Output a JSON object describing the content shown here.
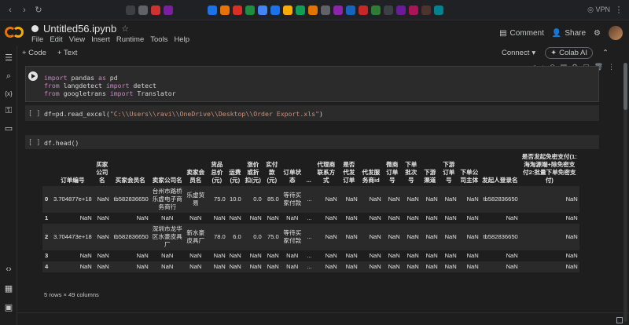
{
  "browser": {
    "vpn_label": "VPN"
  },
  "notebook": {
    "title": "Untitled56.ipynb",
    "menu": [
      "File",
      "Edit",
      "View",
      "Insert",
      "Runtime",
      "Tools",
      "Help"
    ],
    "comment_label": "Comment",
    "share_label": "Share"
  },
  "toolbar": {
    "code_label": "+ Code",
    "text_label": "+ Text",
    "connect_label": "Connect",
    "colab_ai_label": "Colab AI"
  },
  "cells": {
    "cell1": {
      "line1": [
        "import",
        " pandas ",
        "as",
        " pd"
      ],
      "line2": [
        "from",
        " langdetect ",
        "import",
        " detect"
      ],
      "line3": [
        "from",
        " googletrans ",
        "import",
        " Translator"
      ]
    },
    "cell2": {
      "prompt": "[ ]",
      "code_a": "df=pd.read_excel(",
      "code_str": "\"C:\\\\Users\\\\ravi\\\\OneDrive\\\\Desktop\\\\Order Export.xls\"",
      "code_b": ")"
    },
    "cell3": {
      "prompt": "[ ]",
      "code": "df.head()"
    }
  },
  "table": {
    "headers": [
      "",
      "订单编号",
      "买家公司名",
      "买家会员名",
      "卖家公司名",
      "卖家会员名",
      "货品总价(元)",
      "运费(元)",
      "涨价或折扣(元)",
      "实付款(元)",
      "订单状态",
      "...",
      "代理商联系方式",
      "是否代发订单",
      "代发服务商id",
      "微商订单号",
      "下单批次号",
      "下游渠道",
      "下游订单号",
      "下单公司主体",
      "发起人登录名",
      "是否发起免密支付(1:海淘源端+除免密支付2:批量下单免密支付)"
    ],
    "rows": [
      [
        "0",
        "3.704877e+18",
        "NaN",
        "tb582836650",
        "台州市路桥乐虚电子商务商行",
        "乐虚贸易",
        "75.0",
        "10.0",
        "0.0",
        "85.0",
        "等待买家付款",
        "...",
        "NaN",
        "NaN",
        "NaN",
        "NaN",
        "NaN",
        "NaN",
        "NaN",
        "NaN",
        "tb582836650",
        "NaN"
      ],
      [
        "1",
        "NaN",
        "NaN",
        "NaN",
        "NaN",
        "NaN",
        "NaN",
        "NaN",
        "NaN",
        "NaN",
        "NaN",
        "...",
        "NaN",
        "NaN",
        "NaN",
        "NaN",
        "NaN",
        "NaN",
        "NaN",
        "NaN",
        "NaN",
        "NaN"
      ],
      [
        "2",
        "3.704473e+18",
        "NaN",
        "tb582836650",
        "深圳市龙华区水豪皮具厂",
        "新水豪皮具厂",
        "78.0",
        "6.0",
        "0.0",
        "75.0",
        "等待买家付款",
        "...",
        "NaN",
        "NaN",
        "NaN",
        "NaN",
        "NaN",
        "NaN",
        "NaN",
        "NaN",
        "tb582836650",
        "NaN"
      ],
      [
        "3",
        "NaN",
        "NaN",
        "NaN",
        "NaN",
        "NaN",
        "NaN",
        "NaN",
        "NaN",
        "NaN",
        "NaN",
        "...",
        "NaN",
        "NaN",
        "NaN",
        "NaN",
        "NaN",
        "NaN",
        "NaN",
        "NaN",
        "NaN",
        "NaN"
      ],
      [
        "4",
        "NaN",
        "NaN",
        "NaN",
        "NaN",
        "NaN",
        "NaN",
        "NaN",
        "NaN",
        "NaN",
        "NaN",
        "...",
        "NaN",
        "NaN",
        "NaN",
        "NaN",
        "NaN",
        "NaN",
        "NaN",
        "NaN",
        "NaN",
        "NaN"
      ]
    ],
    "shape_text": "5 rows × 49 columns"
  },
  "colors": {
    "background": "#1e1e1e",
    "cell_background": "#2b2b2b",
    "keyword": "#c586c0",
    "string": "#ce9178",
    "logo_orange": "#f9ab00"
  }
}
